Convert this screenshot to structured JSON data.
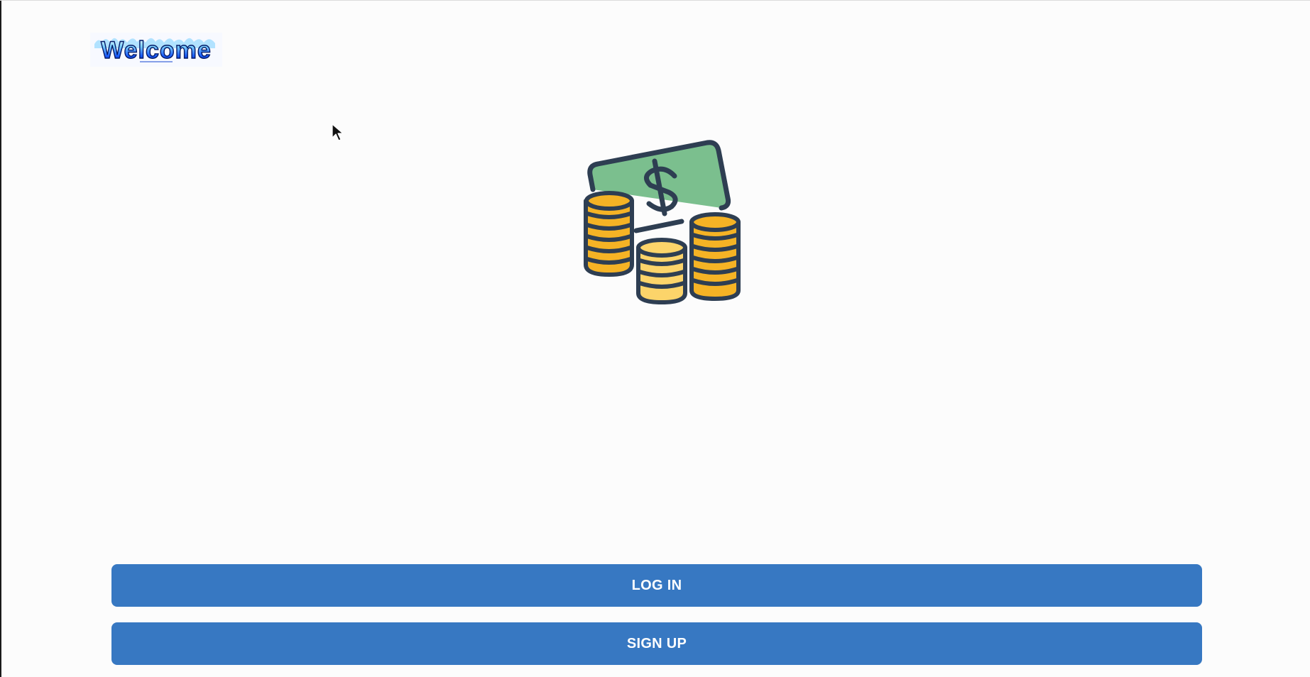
{
  "logo": {
    "text": "Welcome",
    "colors": {
      "fill": "#0a3fd6",
      "outline": "#041a66",
      "flame": "#7fd4ff"
    }
  },
  "hero": {
    "icon": "money-cash-coins-icon",
    "colors": {
      "bill": "#7bbf8e",
      "outline": "#2e3e52",
      "coin_dark": "#f5b325",
      "coin_light": "#fcd46a"
    }
  },
  "actions": {
    "login_label": "LOG IN",
    "signup_label": "SIGN UP",
    "button_color": "#3778c2"
  },
  "cursor": {
    "icon": "mouse-pointer-icon"
  }
}
